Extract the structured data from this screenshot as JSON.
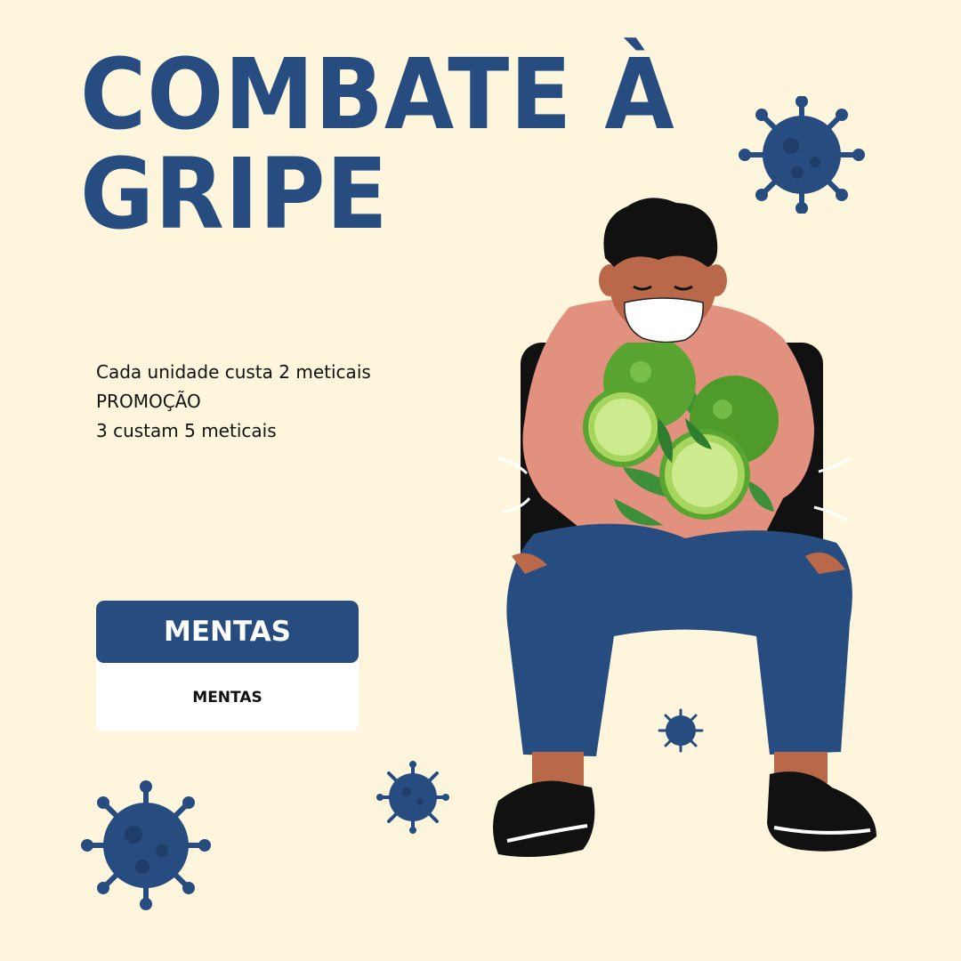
{
  "title": {
    "line1": "COMBATE À",
    "line2": "GRIPE"
  },
  "info": {
    "line1": "Cada unidade custa 2 meticais",
    "line2": "PROMOÇÃO",
    "line3": "3 custam 5 meticais"
  },
  "card": {
    "header": "MENTAS",
    "body": "MENTAS"
  },
  "colors": {
    "background": "#fdf6dc",
    "primary": "#274c7f",
    "skin_shirt": "#e2917e",
    "lime": "#7cc043"
  },
  "icons": [
    "virus-icon",
    "person-with-mask-illustration",
    "lime-mint-image"
  ]
}
